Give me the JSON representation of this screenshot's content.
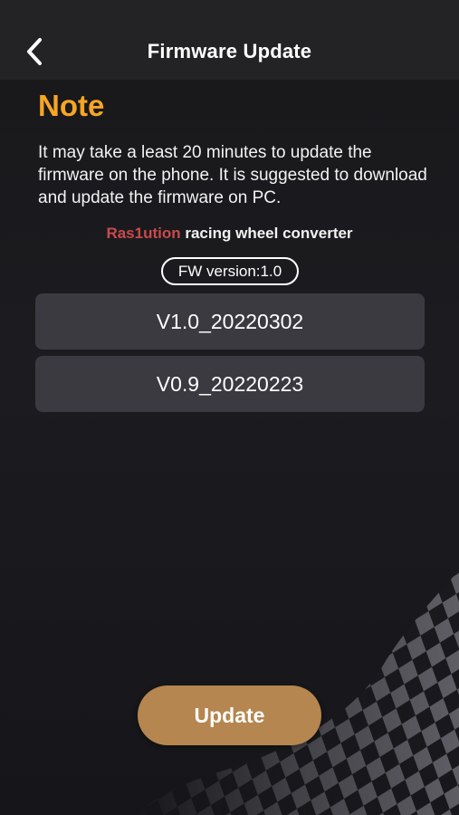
{
  "colors": {
    "accent": "#f5a623",
    "brand": "#c94a4a",
    "button": "#b5864f",
    "list_item_bg": "#3a3a40"
  },
  "header": {
    "back_icon": "chevron-left-icon",
    "title": "Firmware Update"
  },
  "note": {
    "heading": "Note",
    "body": "It may take a least 20 minutes to update the firmware on the phone. It is suggested to download and update the firmware on PC."
  },
  "device": {
    "brand": "Ras1ution",
    "name": " racing wheel converter",
    "fw_version": "FW version:1.0"
  },
  "firmware_list": [
    {
      "label": "V1.0_20220302"
    },
    {
      "label": "V0.9_20220223"
    }
  ],
  "actions": {
    "update_label": "Update"
  }
}
